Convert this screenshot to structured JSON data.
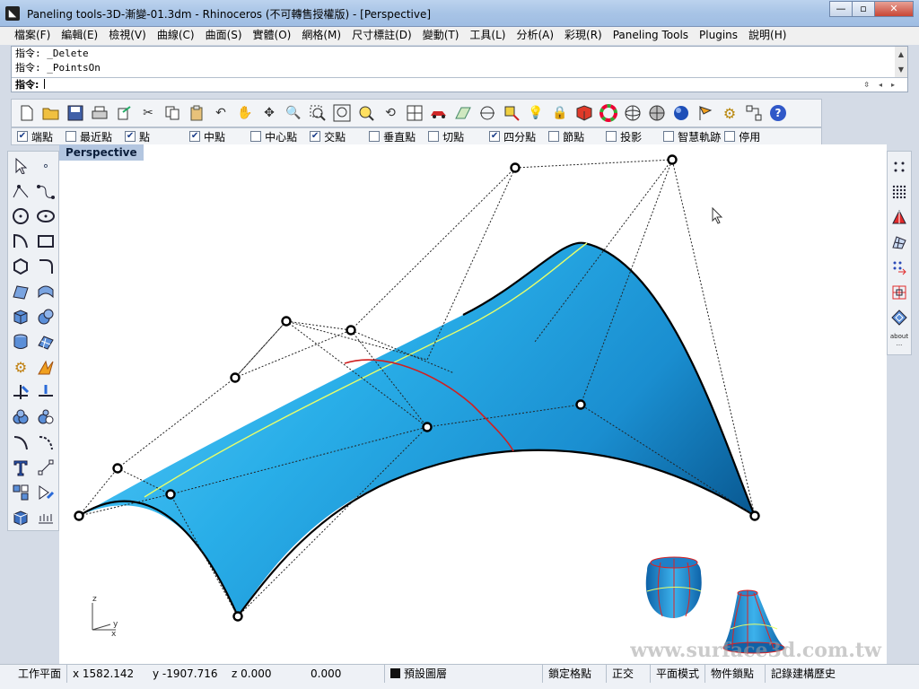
{
  "window": {
    "title": "Paneling tools-3D-漸變-01.3dm - Rhinoceros (不可轉售授權版) - [Perspective]",
    "minimize": "—",
    "restore": "▫",
    "close": "✕"
  },
  "menu": [
    "檔案(F)",
    "編輯(E)",
    "檢視(V)",
    "曲線(C)",
    "曲面(S)",
    "實體(O)",
    "網格(M)",
    "尺寸標註(D)",
    "變動(T)",
    "工具(L)",
    "分析(A)",
    "彩現(R)",
    "Paneling Tools",
    "Plugins",
    "說明(H)"
  ],
  "command": {
    "history": [
      "指令: _Delete",
      "指令: _PointsOn"
    ],
    "prompt": "指令:"
  },
  "toolbar_icons": [
    "new-icon",
    "open-icon",
    "save-icon",
    "print-icon",
    "export-icon",
    "cut-icon",
    "copy-icon",
    "paste-icon",
    "undo-icon",
    "pan-icon",
    "rotate-view-icon",
    "zoom-dynamic-icon",
    "zoom-window-icon",
    "zoom-extents-icon",
    "zoom-selected-icon",
    "undo-view-icon",
    "four-viewports-icon",
    "car-icon",
    "grid-icon",
    "point-icon",
    "osnap-icon",
    "light-icon",
    "lock-icon",
    "layer-icon",
    "color-wheel-icon",
    "wire-sphere-icon",
    "shade-sphere-icon",
    "render-sphere-icon",
    "flag-icon",
    "gear-icon",
    "dimension-icon",
    "help-icon"
  ],
  "osnaps": [
    {
      "label": "端點",
      "checked": true
    },
    {
      "label": "最近點",
      "checked": false
    },
    {
      "label": "點",
      "checked": true
    },
    {
      "label": "中點",
      "checked": true
    },
    {
      "label": "中心點",
      "checked": false
    },
    {
      "label": "交點",
      "checked": true
    },
    {
      "label": "垂直點",
      "checked": false
    },
    {
      "label": "切點",
      "checked": false
    },
    {
      "label": "四分點",
      "checked": true
    },
    {
      "label": "節點",
      "checked": false
    },
    {
      "label": "投影",
      "checked": false
    },
    {
      "label": "智慧軌跡",
      "checked": false
    },
    {
      "label": "停用",
      "checked": false
    }
  ],
  "viewport": {
    "label": "Perspective",
    "watermark": "www.surface3d.com.tw",
    "axes": {
      "x": "x",
      "y": "y",
      "z": "z"
    }
  },
  "right_toolbar": {
    "about_label": "about ..."
  },
  "status": {
    "cplane": "工作平面",
    "x": "x 1582.142",
    "y": "y -1907.716",
    "z": "z 0.000",
    "extra": "0.000",
    "layer": "預設圖層",
    "grid_snap": "鎖定格點",
    "ortho": "正交",
    "planar": "平面模式",
    "osnap": "物件鎖點",
    "history": "記錄建構歷史"
  },
  "colors": {
    "surface_light": "#35b8f0",
    "surface_dark": "#0a5f9a",
    "isocurve_yellow": "#e8ff6a",
    "isocurve_red": "#d02020",
    "viewport_label_bg": "#b3c6e0"
  }
}
